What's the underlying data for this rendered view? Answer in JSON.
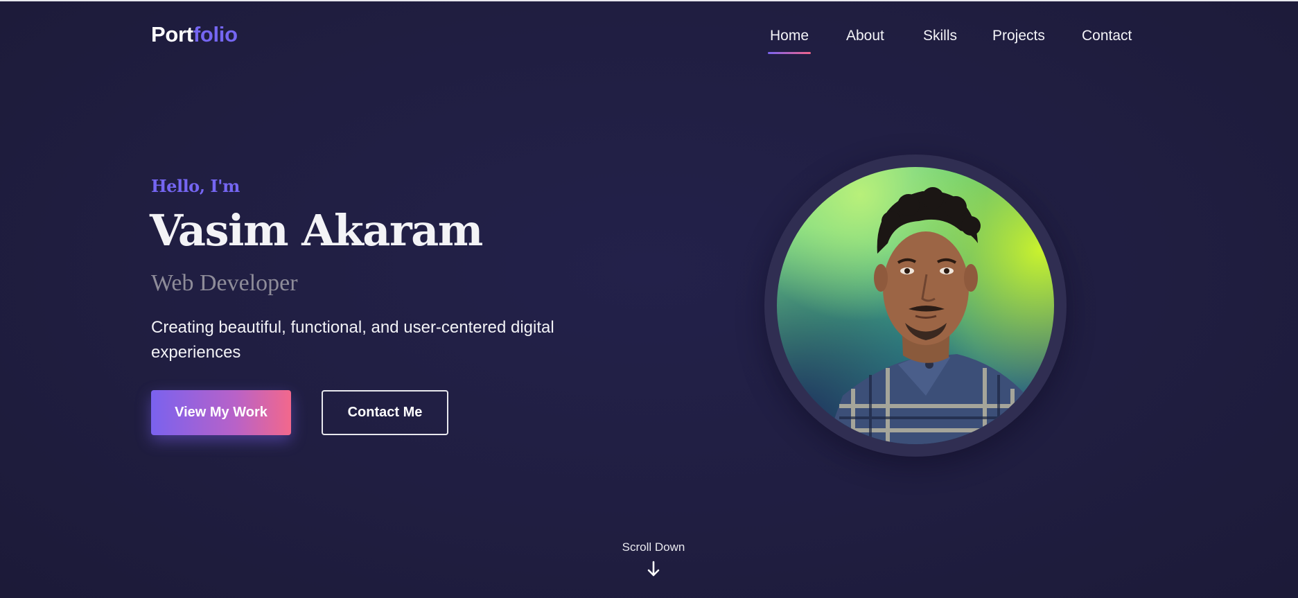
{
  "logo": {
    "part1": "Port",
    "part2": "folio"
  },
  "nav": {
    "items": [
      {
        "label": "Home",
        "active": true
      },
      {
        "label": "About",
        "active": false
      },
      {
        "label": "Skills",
        "active": false
      },
      {
        "label": "Projects",
        "active": false
      },
      {
        "label": "Contact",
        "active": false
      }
    ]
  },
  "hero": {
    "greeting": "Hello, I'm",
    "name": "Vasim Akaram",
    "role": "Web Developer",
    "tagline": "Creating beautiful, functional, and user-centered digital experiences",
    "primary_button": "View My Work",
    "secondary_button": "Contact Me"
  },
  "scroll_hint": {
    "label": "Scroll Down",
    "icon": "arrow-down-icon"
  },
  "colors": {
    "background": "#201e41",
    "accent": "#7566f2",
    "accent_pink": "#f2648a",
    "text_muted": "#8e8c99"
  },
  "avatar": {
    "icon": "profile-photo"
  }
}
